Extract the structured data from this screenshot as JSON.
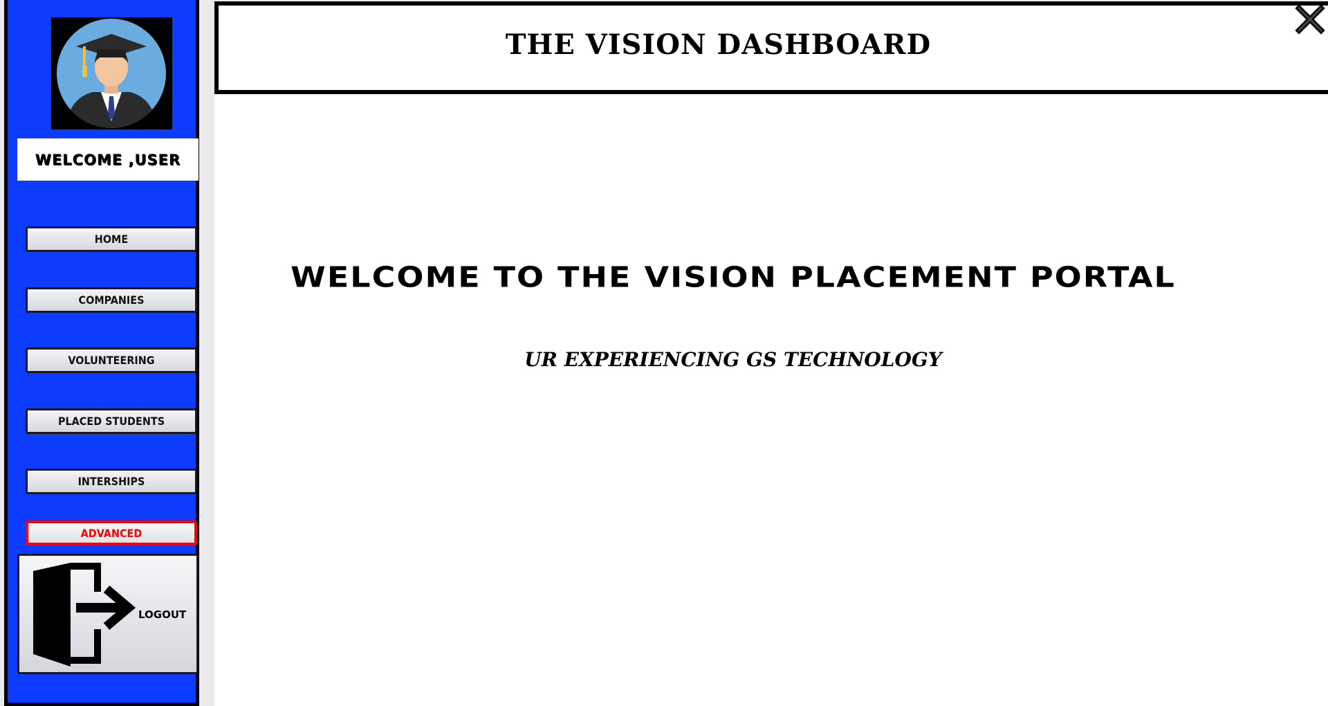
{
  "sidebar": {
    "welcome_text": "WELCOME ,USER",
    "nav": {
      "home": "HOME",
      "companies": "COMPANIES",
      "volunteering": "VOLUNTEERING",
      "placed_students": "PLACED STUDENTS",
      "interships": "INTERSHIPS",
      "advanced": "ADVANCED"
    },
    "logout_label": "LOGOUT"
  },
  "header": {
    "title": "THE VISION DASHBOARD",
    "close_icon": "close-icon"
  },
  "main": {
    "title": "WELCOME TO THE VISION PLACEMENT PORTAL",
    "subtitle": "UR EXPERIENCING GS TECHNOLOGY"
  },
  "colors": {
    "sidebar_bg": "#0d3cff",
    "advanced_accent": "#ff0000",
    "content_bg": "#ffffff"
  }
}
